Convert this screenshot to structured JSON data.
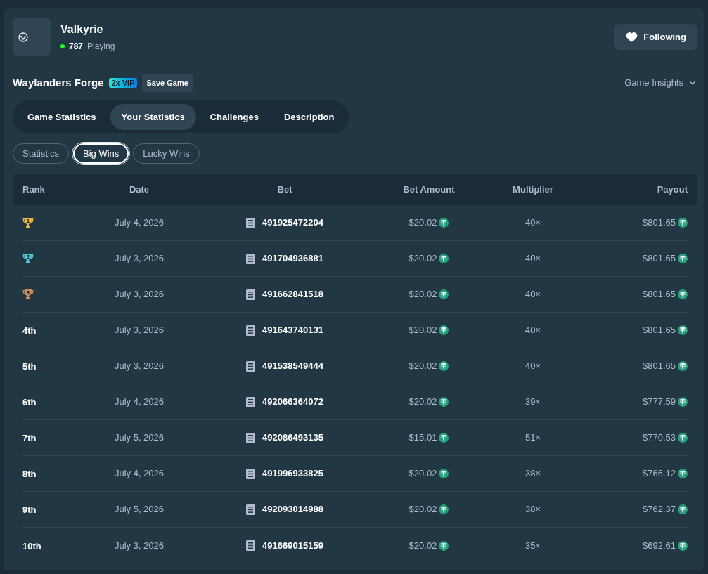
{
  "game": {
    "provider": "Valkyrie",
    "players": "787",
    "players_label": "Playing",
    "follow_button": "Following",
    "title": "Waylanders Forge",
    "badge": "2x VIP",
    "save_button": "Save Game",
    "insights": "Game Insights"
  },
  "tabs": [
    {
      "label": "Game Statistics",
      "selected": false
    },
    {
      "label": "Your Statistics",
      "selected": true
    },
    {
      "label": "Challenges",
      "selected": false
    },
    {
      "label": "Description",
      "selected": false
    }
  ],
  "subtabs": [
    {
      "label": "Statistics",
      "selected": false
    },
    {
      "label": "Big Wins",
      "selected": true
    },
    {
      "label": "Lucky Wins",
      "selected": false
    }
  ],
  "table": {
    "columns": [
      "Rank",
      "Date",
      "Bet",
      "Bet Amount",
      "Multiplier",
      "Payout"
    ],
    "rows": [
      {
        "rank": {
          "kind": "trophy",
          "label": "1",
          "color": "#f2b53a"
        },
        "date": "July 4, 2026",
        "bet": "491925472204",
        "bet_amount": "$20.02",
        "multiplier": "40×",
        "payout": "$801.65"
      },
      {
        "rank": {
          "kind": "trophy",
          "label": "2",
          "color": "#4fc7d2"
        },
        "date": "July 3, 2026",
        "bet": "491704936881",
        "bet_amount": "$20.02",
        "multiplier": "40×",
        "payout": "$801.65"
      },
      {
        "rank": {
          "kind": "trophy",
          "label": "3",
          "color": "#c98c5a"
        },
        "date": "July 3, 2026",
        "bet": "491662841518",
        "bet_amount": "$20.02",
        "multiplier": "40×",
        "payout": "$801.65"
      },
      {
        "rank": {
          "kind": "text",
          "label": "4th"
        },
        "date": "July 3, 2026",
        "bet": "491643740131",
        "bet_amount": "$20.02",
        "multiplier": "40×",
        "payout": "$801.65"
      },
      {
        "rank": {
          "kind": "text",
          "label": "5th"
        },
        "date": "July 3, 2026",
        "bet": "491538549444",
        "bet_amount": "$20.02",
        "multiplier": "40×",
        "payout": "$801.65"
      },
      {
        "rank": {
          "kind": "text",
          "label": "6th"
        },
        "date": "July 4, 2026",
        "bet": "492066364072",
        "bet_amount": "$20.02",
        "multiplier": "39×",
        "payout": "$777.59"
      },
      {
        "rank": {
          "kind": "text",
          "label": "7th"
        },
        "date": "July 5, 2026",
        "bet": "492086493135",
        "bet_amount": "$15.01",
        "multiplier": "51×",
        "payout": "$770.53"
      },
      {
        "rank": {
          "kind": "text",
          "label": "8th"
        },
        "date": "July 4, 2026",
        "bet": "491996933825",
        "bet_amount": "$20.02",
        "multiplier": "38×",
        "payout": "$766.12"
      },
      {
        "rank": {
          "kind": "text",
          "label": "9th"
        },
        "date": "July 5, 2026",
        "bet": "492093014988",
        "bet_amount": "$20.02",
        "multiplier": "38×",
        "payout": "$762.37"
      },
      {
        "rank": {
          "kind": "text",
          "label": "10th"
        },
        "date": "July 3, 2026",
        "bet": "491669015159",
        "bet_amount": "$20.02",
        "multiplier": "35×",
        "payout": "$692.61"
      }
    ]
  }
}
